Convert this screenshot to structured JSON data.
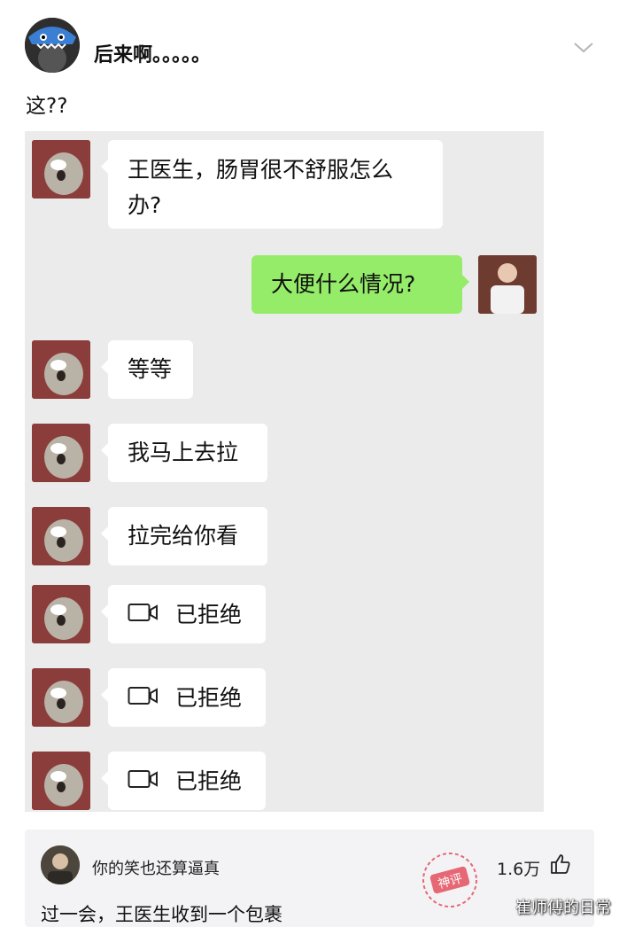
{
  "post": {
    "username": "后来啊。。。。。",
    "text": "这??"
  },
  "chat": {
    "messages": [
      {
        "side": "left",
        "type": "text",
        "text": "王医生，肠胃很不舒服怎么办?"
      },
      {
        "side": "right",
        "type": "text",
        "text": "大便什么情况?"
      },
      {
        "side": "left",
        "type": "text",
        "text": "等等"
      },
      {
        "side": "left",
        "type": "text",
        "text": "我马上去拉"
      },
      {
        "side": "left",
        "type": "text",
        "text": "拉完给你看"
      },
      {
        "side": "left",
        "type": "video_call",
        "icon": "video-call-icon",
        "text": "已拒绝"
      },
      {
        "side": "left",
        "type": "video_call",
        "icon": "video-call-icon",
        "text": "已拒绝"
      },
      {
        "side": "left",
        "type": "video_call",
        "icon": "video-call-icon",
        "text": "已拒绝"
      }
    ]
  },
  "comment": {
    "username": "你的笑也还算逼真",
    "likes": "1.6万",
    "text": "过一会，王医生收到一个包裹",
    "badge": "神评"
  },
  "watermark": "崔师傅的日常",
  "colors": {
    "sent_bubble": "#95ec69",
    "received_bubble": "#ffffff",
    "chat_background": "#ebebeb",
    "stamp": "#e23a4a"
  }
}
